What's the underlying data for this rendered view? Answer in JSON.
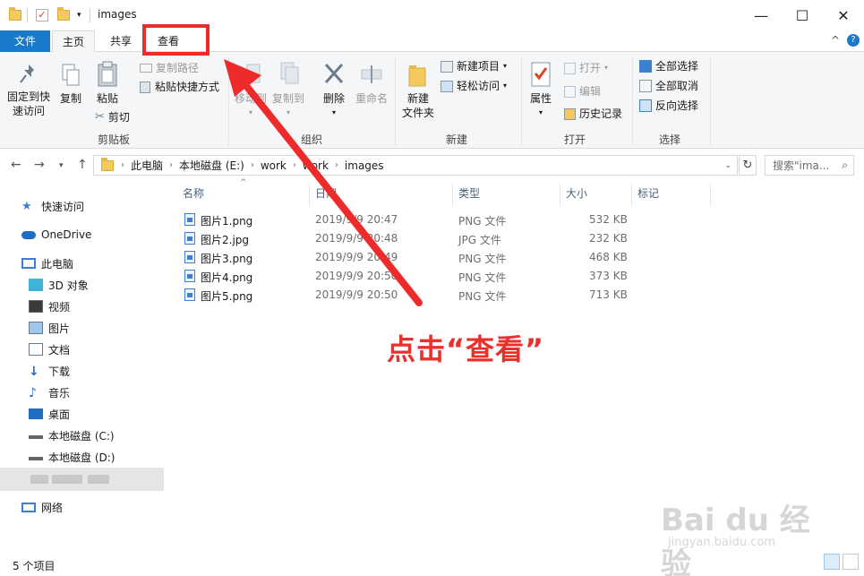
{
  "window": {
    "title": "images",
    "minimize": "—",
    "maximize": "☐",
    "close": "✕"
  },
  "tabs": {
    "file": "文件",
    "home": "主页",
    "share": "共享",
    "view": "查看",
    "collapse": "^",
    "help": "?"
  },
  "ribbon": {
    "clipboard": {
      "pin": "固定到快\n速访问",
      "copy": "复制",
      "paste": "粘贴",
      "copy_path": "复制路径",
      "paste_shortcut": "粘贴快捷方式",
      "cut": "剪切",
      "label": "剪贴板"
    },
    "organize": {
      "move_to": "移动到",
      "copy_to": "复制到",
      "delete": "删除",
      "rename": "重命名",
      "label": "组织"
    },
    "new": {
      "new_folder": "新建\n文件夹",
      "new_item": "新建项目",
      "easy_access": "轻松访问",
      "label": "新建"
    },
    "open": {
      "properties": "属性",
      "open": "打开",
      "edit": "编辑",
      "history": "历史记录",
      "label": "打开"
    },
    "select": {
      "select_all": "全部选择",
      "select_none": "全部取消",
      "invert": "反向选择",
      "label": "选择"
    }
  },
  "address": {
    "crumbs": [
      "此电脑",
      "本地磁盘 (E:)",
      "work",
      "work",
      "images"
    ],
    "search_placeholder": "搜索\"ima..."
  },
  "nav": {
    "quick_access": "快速访问",
    "onedrive": "OneDrive",
    "this_pc": "此电脑",
    "items": [
      "3D 对象",
      "视频",
      "图片",
      "文档",
      "下载",
      "音乐",
      "桌面",
      "本地磁盘 (C:)",
      "本地磁盘 (D:)"
    ],
    "network": "网络"
  },
  "columns": {
    "name": "名称",
    "date": "日期",
    "type": "类型",
    "size": "大小",
    "tags": "标记"
  },
  "files": [
    {
      "name": "图片1.png",
      "date": "2019/9/9 20:47",
      "type": "PNG 文件",
      "size": "532 KB"
    },
    {
      "name": "图片2.jpg",
      "date": "2019/9/9 20:48",
      "type": "JPG 文件",
      "size": "232 KB"
    },
    {
      "name": "图片3.png",
      "date": "2019/9/9 20:49",
      "type": "PNG 文件",
      "size": "468 KB"
    },
    {
      "name": "图片4.png",
      "date": "2019/9/9 20:50",
      "type": "PNG 文件",
      "size": "373 KB"
    },
    {
      "name": "图片5.png",
      "date": "2019/9/9 20:50",
      "type": "PNG 文件",
      "size": "713 KB"
    }
  ],
  "status": {
    "count": "5 个项目"
  },
  "annotation": {
    "text": "点击“查看”",
    "color": "#ee2b2b"
  },
  "watermark": {
    "brand": "Bai du 经验",
    "url": "jingyan.baidu.com"
  }
}
